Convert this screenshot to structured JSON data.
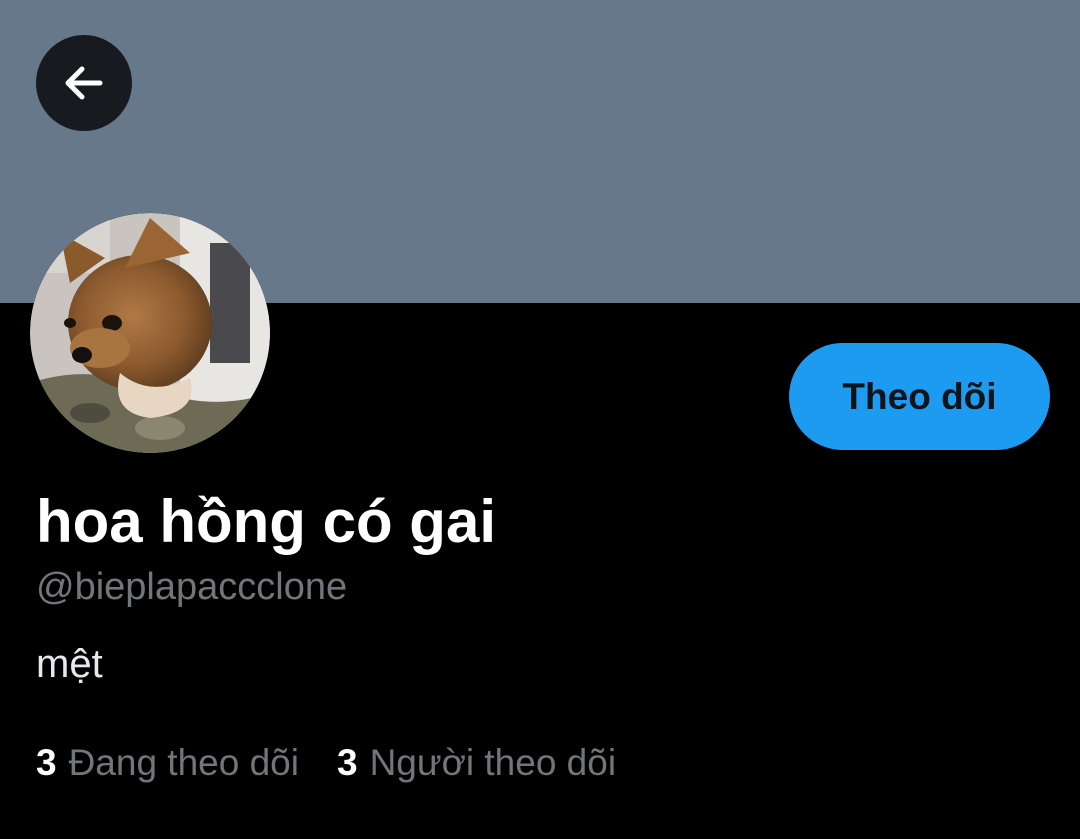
{
  "header": {
    "banner_color": "#66788a",
    "back_icon": "arrow-left-icon"
  },
  "profile": {
    "display_name": "hoa hồng có gai",
    "handle": "@bieplapaccclone",
    "bio": "mệt",
    "avatar_description_icon": "dog-avatar"
  },
  "actions": {
    "follow_label": "Theo dõi"
  },
  "stats": {
    "following_count": "3",
    "following_label": "Đang theo dõi",
    "followers_count": "3",
    "followers_label": "Người theo dõi"
  },
  "colors": {
    "accent": "#1d9bf0",
    "background": "#000000",
    "secondary_text": "#71767b"
  }
}
